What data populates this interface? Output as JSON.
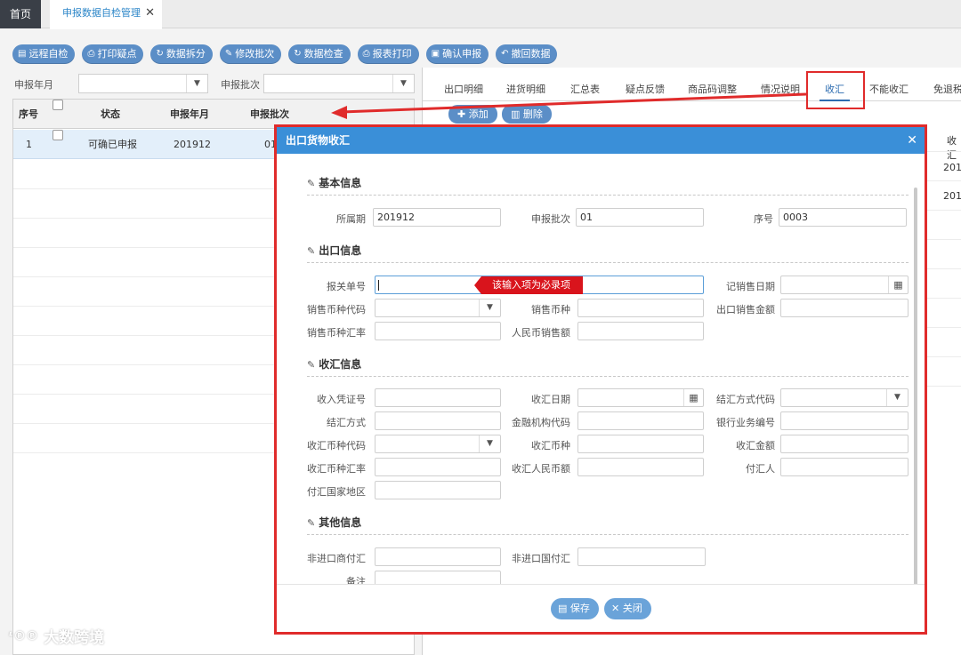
{
  "tabs": {
    "home": "首页",
    "page": "申报数据自检管理"
  },
  "toolbar": [
    {
      "icon": "server-icon",
      "glyph": "▤",
      "label": "远程自检"
    },
    {
      "icon": "print-icon",
      "glyph": "⎙",
      "label": "打印疑点"
    },
    {
      "icon": "refresh-icon",
      "glyph": "↻",
      "label": "数据拆分"
    },
    {
      "icon": "edit-icon",
      "glyph": "✎",
      "label": "修改批次"
    },
    {
      "icon": "refresh-icon",
      "glyph": "↻",
      "label": "数据检查"
    },
    {
      "icon": "print-icon",
      "glyph": "⎙",
      "label": "报表打印"
    },
    {
      "icon": "confirm-icon",
      "glyph": "▣",
      "label": "确认申报"
    },
    {
      "icon": "undo-icon",
      "glyph": "↶",
      "label": "撤回数据"
    }
  ],
  "filter": {
    "year_month_label": "申报年月",
    "batch_label": "申报批次"
  },
  "left_grid": {
    "columns": [
      "序号",
      "状态",
      "申报年月",
      "申报批次",
      "状态"
    ],
    "rows": [
      {
        "index": "1",
        "status": "可确已申报",
        "year_month": "201912",
        "batch": "01"
      }
    ]
  },
  "right": {
    "tabs": [
      "出口明细",
      "进货明细",
      "汇总表",
      "疑点反馈",
      "商品码调整",
      "情况说明",
      "收汇",
      "不能收汇",
      "免退税"
    ],
    "active_tab": "收汇",
    "add_label": "添加",
    "delete_label": "删除",
    "head_text": "收汇",
    "values": [
      "201",
      "201"
    ]
  },
  "modal": {
    "title": "出口货物收汇",
    "sections": {
      "basic": "基本信息",
      "export": "出口信息",
      "receipt": "收汇信息",
      "other": "其他信息"
    },
    "basic": {
      "period_label": "所属期",
      "period_value": "201912",
      "batch_label": "申报批次",
      "batch_value": "01",
      "seq_label": "序号",
      "seq_value": "0003"
    },
    "export": {
      "customs_no_label": "报关单号",
      "customs_no_value": "",
      "sale_date_label": "记销售日期",
      "currency_code_label": "销售币种代码",
      "currency_label": "销售币种",
      "export_amount_label": "出口销售金额",
      "exchange_rate_label": "销售币种汇率",
      "rmb_sales_label": "人民币销售额"
    },
    "required_tip": "该输入项为必录项",
    "receipt": {
      "voucher_label": "收入凭证号",
      "date_label": "收汇日期",
      "settle_code_label": "结汇方式代码",
      "settle_label": "结汇方式",
      "bank_code_label": "金融机构代码",
      "bank_ref_label": "银行业务编号",
      "currency_code_label": "收汇币种代码",
      "currency_label": "收汇币种",
      "amount_label": "收汇金额",
      "rate_label": "收汇币种汇率",
      "rmb_label": "收汇人民币额",
      "payer_label": "付汇人",
      "country_label": "付汇国家地区"
    },
    "other": {
      "non_importer_label": "非进口商付汇",
      "non_country_label": "非进口国付汇",
      "remark_label": "备注"
    },
    "save_label": "保存",
    "close_label": "关闭"
  },
  "watermark": "大数跨境",
  "colors": {
    "accent": "#3a8fd8",
    "button": "#5b8ec7",
    "highlight_red": "#e02b2b",
    "tip_red": "#d9141c"
  }
}
